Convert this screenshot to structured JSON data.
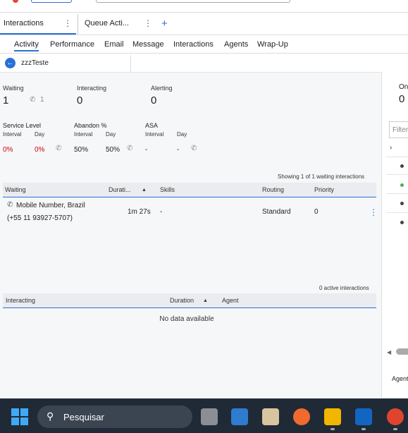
{
  "app_tabs": [
    {
      "label": "Interactions"
    },
    {
      "label": "Queue Acti..."
    }
  ],
  "sub_tabs": [
    "Activity",
    "Performance",
    "Email",
    "Message",
    "Interactions",
    "Agents",
    "Wrap-Up"
  ],
  "active_sub_tab": "Activity",
  "queue_name": "zzzTeste",
  "stats": {
    "waiting_label": "Waiting",
    "waiting_value": "1",
    "waiting_callback": "1",
    "interacting_label": "Interacting",
    "interacting_value": "0",
    "alerting_label": "Alerting",
    "alerting_value": "0"
  },
  "metrics": {
    "service_level_label": "Service Level",
    "abandon_label": "Abandon %",
    "asa_label": "ASA",
    "interval_label": "Interval",
    "day_label": "Day",
    "sl_interval": "0%",
    "sl_day": "0%",
    "ab_interval": "50%",
    "ab_day": "50%",
    "asa_interval": "-",
    "asa_day": "-"
  },
  "waiting_table": {
    "caption": "Showing 1 of 1 waiting interactions",
    "headers": [
      "Waiting",
      "Durati...",
      "Skills",
      "Routing",
      "Priority"
    ],
    "rows": [
      {
        "waiting_line1": "Mobile Number, Brazil",
        "waiting_line2": "(+55 11 93927-5707)",
        "duration": "1m 27s",
        "skills": "-",
        "routing": "Standard",
        "priority": "0"
      }
    ]
  },
  "interacting_table": {
    "caption": "0 active interactions",
    "headers": [
      "Interacting",
      "Duration",
      "Agent"
    ],
    "empty_text": "No data available"
  },
  "right_pane": {
    "on_label": "On",
    "on_value": "0",
    "filter_placeholder": "Filter",
    "agent_label": "Agent"
  },
  "taskbar": {
    "search_placeholder": "Pesquisar",
    "colors": {
      "bar": "#1f2a36",
      "accent": "#2a6fd6",
      "red": "#d0021b"
    }
  }
}
